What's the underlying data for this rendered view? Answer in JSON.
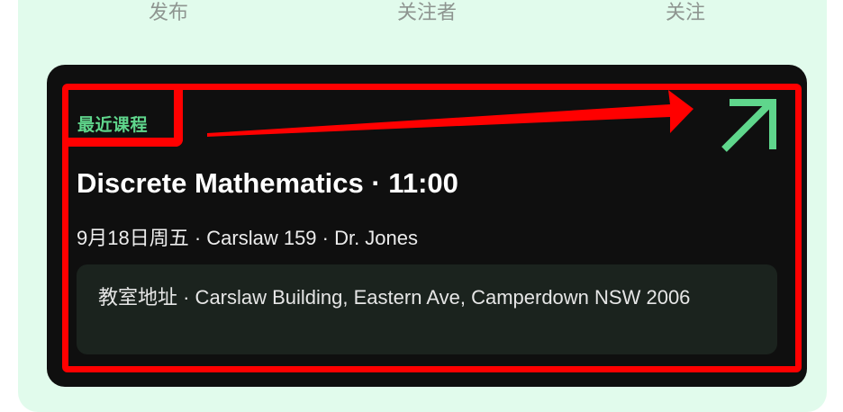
{
  "tabs": [
    {
      "label": "发布"
    },
    {
      "label": "关注者"
    },
    {
      "label": "关注"
    }
  ],
  "course_card": {
    "kicker": "最近课程",
    "title": "Discrete Mathematics · 11:00",
    "meta": "9月18日周五 · Carslaw 159 · Dr. Jones",
    "address": "教室地址 · Carslaw Building, Eastern Ave, Camperdown NSW 2006",
    "open_icon": "arrow-up-right-icon"
  },
  "colors": {
    "mint_background": "#e1fbec",
    "card_background": "#0f0f0f",
    "accent_green": "#5fd68c",
    "annotation_red": "#ff0000",
    "address_box": "#1b231e",
    "tab_text": "#8e9590"
  }
}
